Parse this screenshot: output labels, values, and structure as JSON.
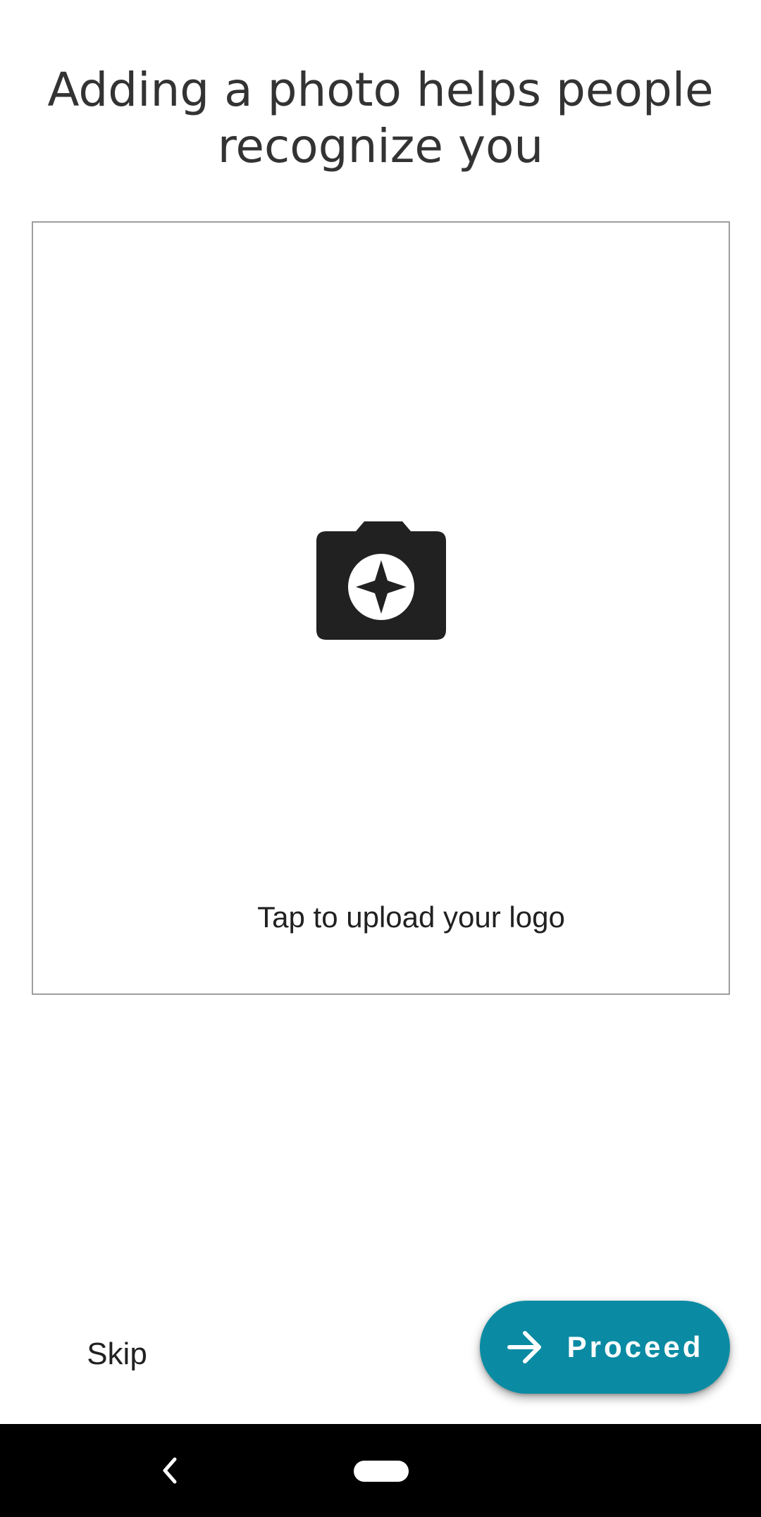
{
  "header": {
    "title_line1": "Adding a photo helps people",
    "title_line2": "recognize you"
  },
  "upload": {
    "icon": "camera-icon",
    "label": "Tap to upload your logo"
  },
  "actions": {
    "skip_label": "Skip",
    "proceed_label": "Proceed",
    "proceed_icon": "arrow-right-icon"
  },
  "nav": {
    "back_icon": "back-chevron-icon",
    "home_icon": "home-pill-icon"
  },
  "colors": {
    "accent": "#0a8ba3",
    "title_text": "#333333",
    "body_text": "#212121",
    "border": "#9e9e9e",
    "nav_bar": "#000000"
  }
}
